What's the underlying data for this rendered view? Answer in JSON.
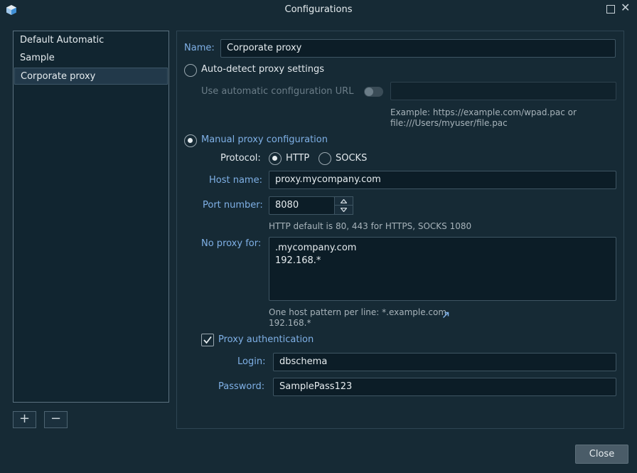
{
  "window": {
    "title": "Configurations"
  },
  "configs": [
    {
      "label": "Default Automatic"
    },
    {
      "label": "Sample"
    },
    {
      "label": "Corporate proxy"
    }
  ],
  "list_buttons": {
    "add": "+",
    "remove": "−"
  },
  "form": {
    "name_label": "Name:",
    "name_value": "Corporate proxy",
    "auto_detect_label": "Auto-detect proxy settings",
    "auto_url_label": "Use automatic configuration URL",
    "auto_url_value": "",
    "auto_url_hint": "Example: https://example.com/wpad.pac or\nfile:///Users/myuser/file.pac",
    "manual_label": "Manual proxy configuration",
    "protocol_label": "Protocol:",
    "protocol_http": "HTTP",
    "protocol_socks": "SOCKS",
    "host_label": "Host name:",
    "host_value": "proxy.mycompany.com",
    "port_label": "Port number:",
    "port_value": "8080",
    "port_hint": "HTTP default is 80, 443 for HTTPS, SOCKS 1080",
    "noproxy_label": "No proxy for:",
    "noproxy_value": ".mycompany.com\n192.168.*",
    "noproxy_hint": "One host pattern per line: *.example.com\n192.168.*",
    "auth_label": "Proxy authentication",
    "login_label": "Login:",
    "login_value": "dbschema",
    "password_label": "Password:",
    "password_value": "SamplePass123"
  },
  "state": {
    "selected_config": "Corporate proxy",
    "mode": "manual",
    "protocol": "HTTP",
    "auth_enabled": true,
    "auto_url_enabled": false
  },
  "footer": {
    "close_label": "Close"
  },
  "colors": {
    "background": "#162a35",
    "accent_label": "#7fb0e6",
    "field_bg": "#0c1d27"
  }
}
